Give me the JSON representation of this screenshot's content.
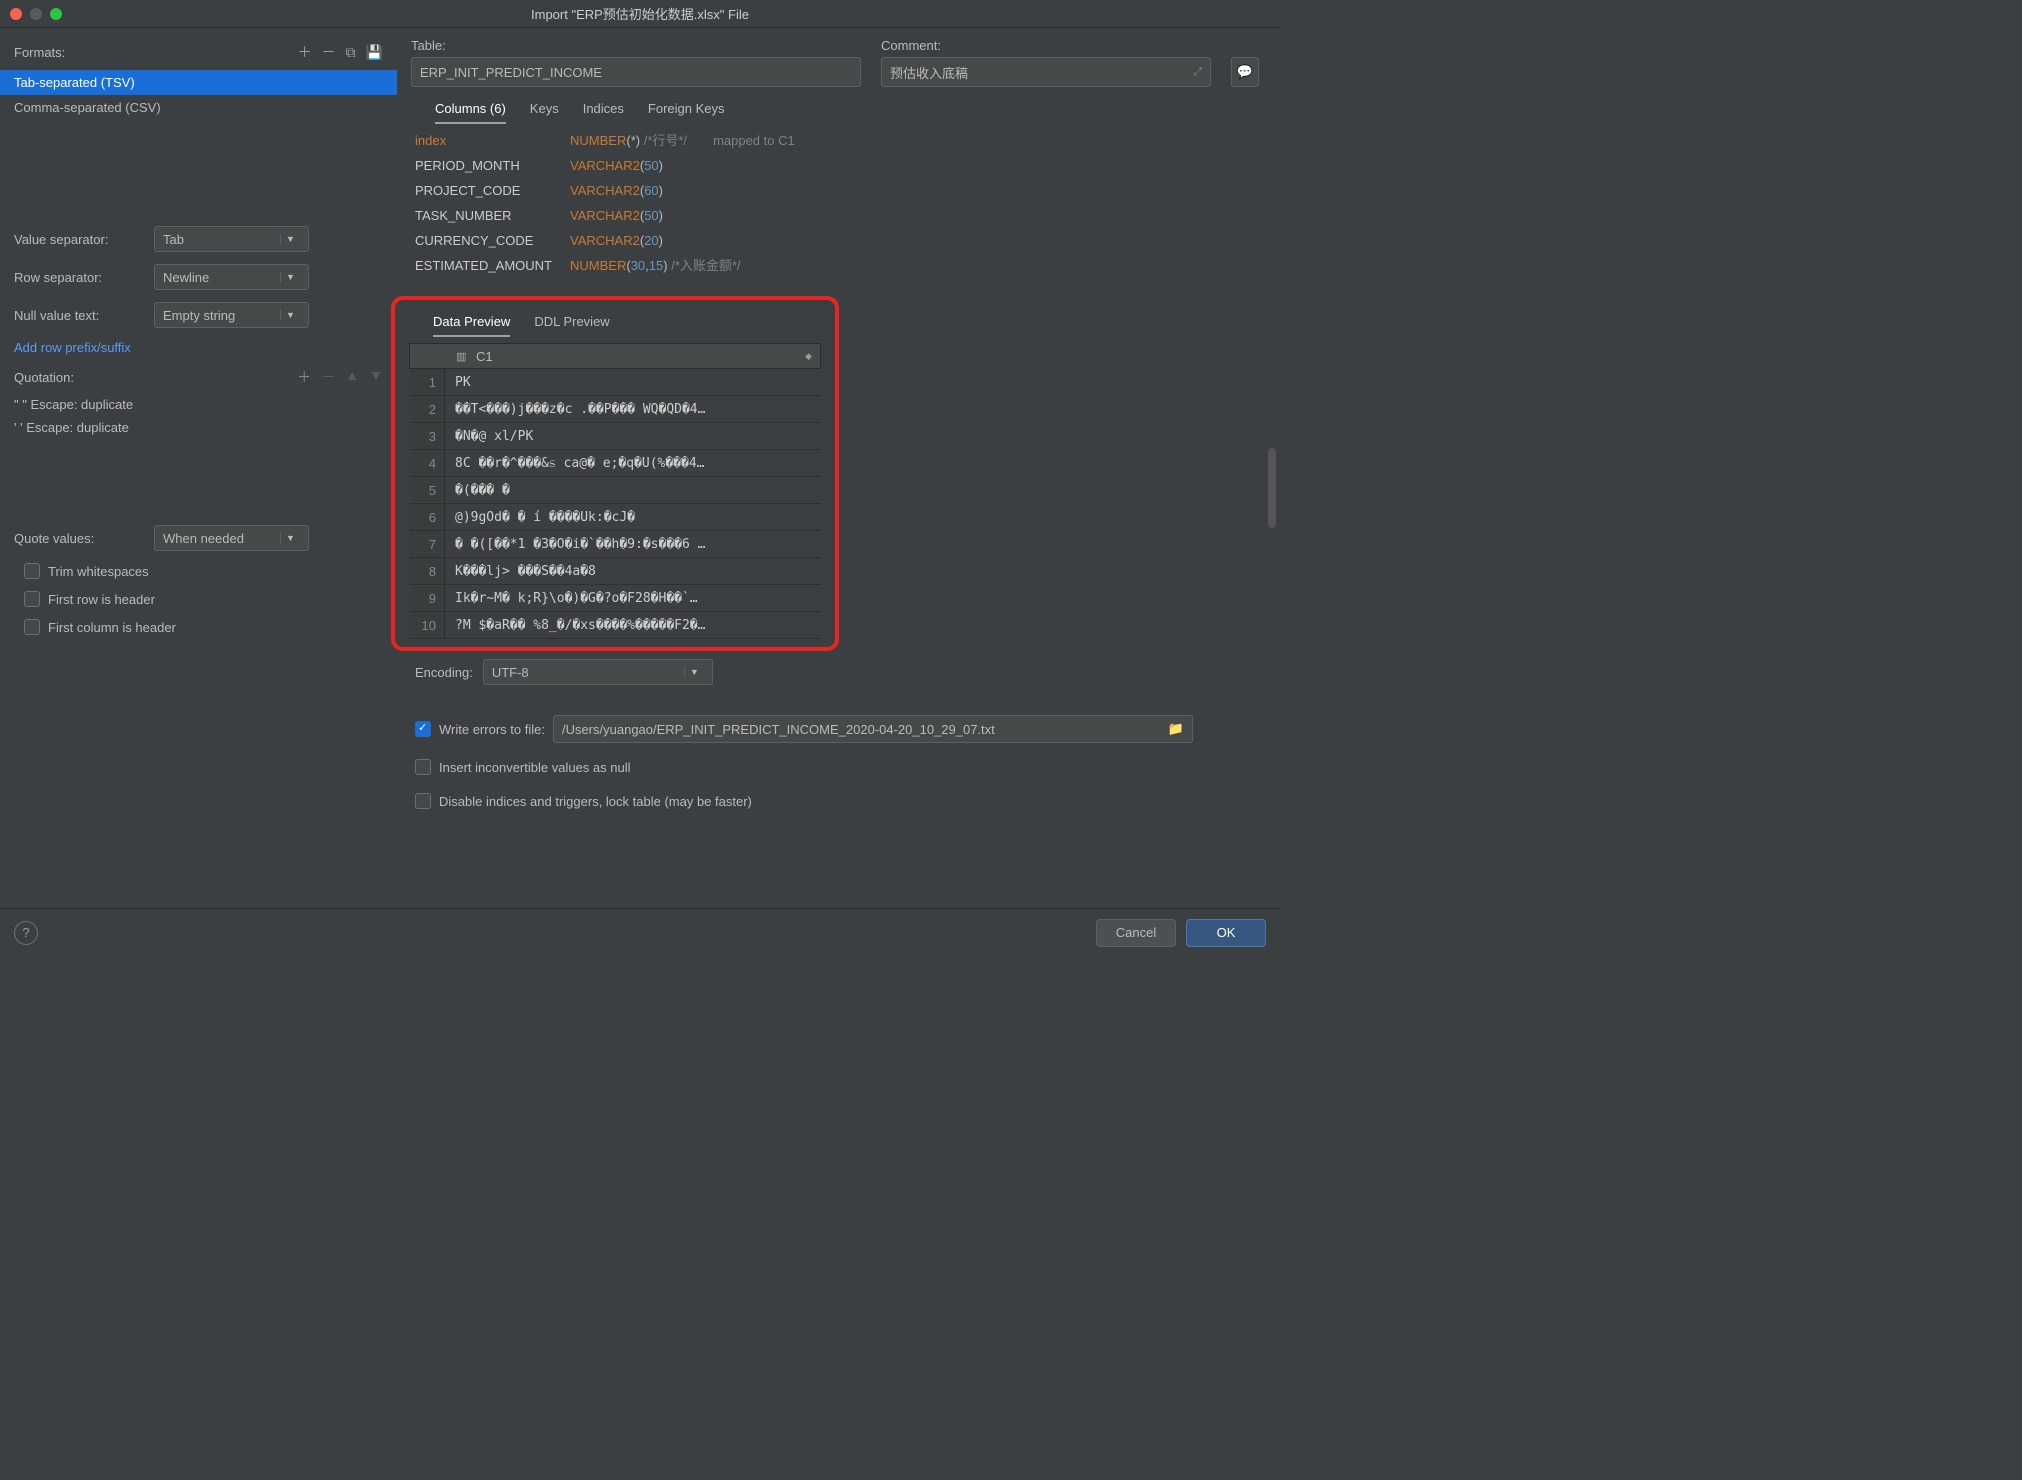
{
  "title": "Import \"ERP预估初始化数据.xlsx\" File",
  "left": {
    "formats_label": "Formats:",
    "formats": [
      {
        "label": "Tab-separated (TSV)",
        "selected": true
      },
      {
        "label": "Comma-separated (CSV)",
        "selected": false
      }
    ],
    "value_separator_label": "Value separator:",
    "value_separator": "Tab",
    "row_separator_label": "Row separator:",
    "row_separator": "Newline",
    "null_value_label": "Null value text:",
    "null_value": "Empty string",
    "add_prefix_link": "Add row prefix/suffix",
    "quotation_label": "Quotation:",
    "quotations": [
      "\"  \"  Escape: duplicate",
      "'  '  Escape: duplicate"
    ],
    "quote_values_label": "Quote values:",
    "quote_values": "When needed",
    "trim_ws": "Trim whitespaces",
    "first_row_header": "First row is header",
    "first_col_header": "First column is header"
  },
  "right": {
    "table_label": "Table:",
    "table_value": "ERP_INIT_PREDICT_INCOME",
    "comment_label": "Comment:",
    "comment_value": "预估收入底稿",
    "tabs": {
      "columns": "Columns (6)",
      "keys": "Keys",
      "indices": "Indices",
      "fk": "Foreign Keys"
    },
    "columns": [
      {
        "name": "index",
        "type": "NUMBER",
        "args": "(*)",
        "comment": "/*行号*/",
        "mapped": "mapped to C1",
        "is_index": true
      },
      {
        "name": "PERIOD_MONTH",
        "type": "VARCHAR2",
        "args": "(50)"
      },
      {
        "name": "PROJECT_CODE",
        "type": "VARCHAR2",
        "args": "(60)"
      },
      {
        "name": "TASK_NUMBER",
        "type": "VARCHAR2",
        "args": "(50)"
      },
      {
        "name": "CURRENCY_CODE",
        "type": "VARCHAR2",
        "args": "(20)"
      },
      {
        "name": "ESTIMATED_AMOUNT",
        "type": "NUMBER",
        "args": "(30,15)",
        "comment": "/*入账金额*/"
      }
    ],
    "preview_tabs": {
      "data": "Data Preview",
      "ddl": "DDL Preview"
    },
    "preview_col": "C1",
    "preview_rows": [
      "PK",
      "��T<���)j���z�c .��P��� WQ�QD�4…",
      "�N�@ xl/PK",
      "8C ��r�^���&ಽ ca@� e;�q�U(%���4…",
      "  �(��� �",
      "@)9gOd� � í ����Uk:�cJ�",
      "� �([��*1 �3�O�i�`��h�9:�s���6 …",
      "K���lj> ���S��4a�8",
      "Ik�r~M� k;R}\\o�)�G�?o�F28�H��`…",
      "?M $�aR�� %8_�/�xs����%�����F2�…"
    ],
    "encoding_label": "Encoding:",
    "encoding_value": "UTF-8",
    "write_errors_label": "Write errors to file:",
    "write_errors_path": "/Users/yuangao/ERP_INIT_PREDICT_INCOME_2020-04-20_10_29_07.txt",
    "insert_null_label": "Insert inconvertible values as null",
    "disable_indices_label": "Disable indices and triggers, lock table (may be faster)"
  },
  "footer": {
    "cancel": "Cancel",
    "ok": "OK"
  }
}
